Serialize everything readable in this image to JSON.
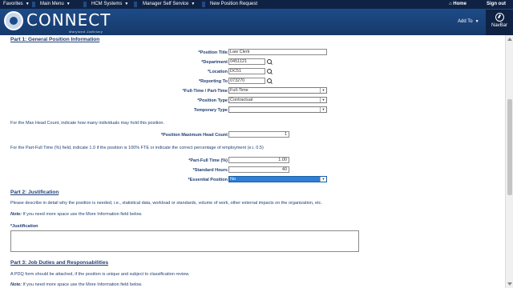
{
  "topmenu": {
    "favorites": "Favorites",
    "main_menu": "Main Menu",
    "hcm_systems": "HCM Systems",
    "manager_self_service": "Manager Self Service",
    "new_position_request": "New Position Request",
    "home": "Home",
    "sign_out": "Sign out"
  },
  "banner": {
    "logo_text": "CONNECT",
    "logo_sub": "Maryland Judiciary",
    "add_to": "Add To",
    "navbar": "NavBar"
  },
  "part1": {
    "heading": "Part 1: General Position Information",
    "position_title_label": "*Position Title",
    "position_title_value": "Law Clerk",
    "department_label": "*Department",
    "department_value": "0451121",
    "location_label": "*Location",
    "location_value": "DC51",
    "reporting_to_label": "*Reporting To",
    "reporting_to_value": "073270",
    "full_part_label": "*Full-Time / Part-Time",
    "full_part_value": "Full-Time",
    "position_type_label": "*Position Type",
    "position_type_value": "Contractual",
    "temporary_type_label": "Temporary Type",
    "temporary_type_value": "",
    "max_head_note": "For the Max Head Count, indicate how many individuals may hold this position.",
    "max_head_label": "*Position Maximum Head Count",
    "max_head_value": "1",
    "part_full_note": "For the Part-Full Time (%) field, indicate 1.0 if the position is 100% FTE or indicate the correct percentage of employment (e.i.  0.5)",
    "part_full_label": "*Part-Full Time (%)",
    "part_full_value": "1.00",
    "std_hours_label": "*Standard Hours",
    "std_hours_value": "40",
    "essential_label": "*Essential Position",
    "essential_value": "No"
  },
  "part2": {
    "heading": "Part 2: Justification",
    "desc": "Please describe in detail why the position is needed, i.e., statistical data, workload or standards, volume of work, other external impacts on the organization, etc.",
    "note_prefix": "Note:",
    "note_text": " If you need more space use the More Information field below.",
    "justification_label": "*Justification"
  },
  "part3": {
    "heading": "Part 3: Job Duties and Responsabilities",
    "desc": "A PDQ form should be attached, if the position is unique and subject to classification review.",
    "note_prefix": "Note:",
    "note_text": " If you need more space use the More Information field below."
  },
  "colors": {
    "topbar": "#0f2244",
    "banner": "#1d4b88",
    "label": "#1f3e73",
    "highlight": "#2f7fd4"
  }
}
